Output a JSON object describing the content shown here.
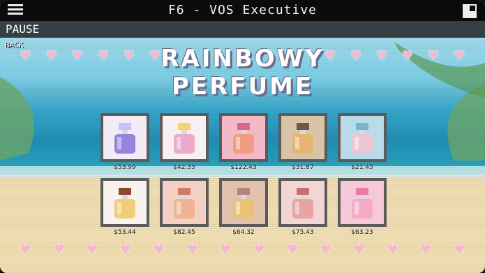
{
  "window": {
    "title": "F6 - VOS Executive"
  },
  "pause_label": "PAUSE",
  "back_label": "BACK",
  "store": {
    "title_line1": "RAINBOWY",
    "title_line2": "PERFUME",
    "products": [
      {
        "price": "$53.99",
        "bg": "#f1ecf6",
        "bottle": "#8b7ad9",
        "cap": "#c9c0ff"
      },
      {
        "price": "$42.33",
        "bg": "#f7f0f3",
        "bottle": "#e9a1c8",
        "cap": "#f7d36e"
      },
      {
        "price": "$122.43",
        "bg": "#f3b9c6",
        "bottle": "#f19a7a",
        "cap": "#d76a8c"
      },
      {
        "price": "$31.87",
        "bg": "#d8c4a8",
        "bottle": "#e7b46b",
        "cap": "#6b5a4a"
      },
      {
        "price": "$21.45",
        "bg": "#b9dbe9",
        "bottle": "#f1c2d3",
        "cap": "#7ab2d0"
      },
      {
        "price": "$53.44",
        "bg": "#f8f3ee",
        "bottle": "#f0c86c",
        "cap": "#8b4a2f"
      },
      {
        "price": "$82.45",
        "bg": "#f2d0c4",
        "bottle": "#f0b08f",
        "cap": "#d07a6a"
      },
      {
        "price": "$64.32",
        "bg": "#e3c2ad",
        "bottle": "#e9c26e",
        "cap": "#b5857a"
      },
      {
        "price": "$75.43",
        "bg": "#f2d6d6",
        "bottle": "#e79fa0",
        "cap": "#c6706d"
      },
      {
        "price": "$63.23",
        "bg": "#f6c9d9",
        "bottle": "#f5a6c3",
        "cap": "#e97aa9"
      }
    ]
  }
}
